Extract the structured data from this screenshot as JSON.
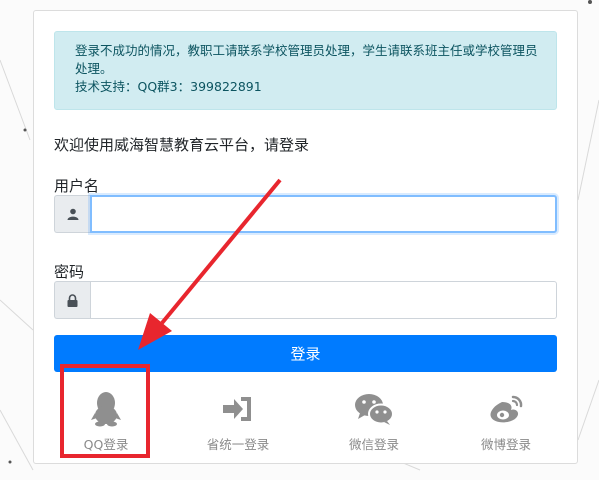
{
  "alert": {
    "line1": "登录不成功的情况，教职工请联系学校管理员处理，学生请联系班主任或学校管理员处理。",
    "line2": "技术支持：QQ群3：399822891"
  },
  "welcome": "欢迎使用威海智慧教育云平台，请登录",
  "username": {
    "label": "用户名",
    "value": "",
    "icon": "user-icon"
  },
  "password": {
    "label": "密码",
    "value": "",
    "icon": "lock-icon"
  },
  "login_button": "登录",
  "alt_logins": [
    {
      "label": "QQ登录",
      "icon": "qq-icon"
    },
    {
      "label": "省统一登录",
      "icon": "sign-in-icon"
    },
    {
      "label": "微信登录",
      "icon": "wechat-icon"
    },
    {
      "label": "微博登录",
      "icon": "weibo-icon"
    }
  ],
  "colors": {
    "primary": "#007bff",
    "alert_bg": "#d1ecf1",
    "alert_text": "#0c5460",
    "highlight": "#e8262e",
    "icon_gray": "#8a8a8a"
  }
}
